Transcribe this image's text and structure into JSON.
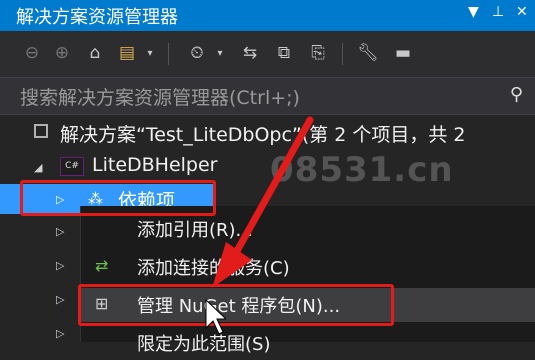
{
  "window": {
    "title": "解决方案资源管理器",
    "pin_glyph": "▾",
    "pin2_glyph": "ǂ",
    "close_glyph": "✕"
  },
  "toolbar": {
    "icons": [
      "back-icon",
      "forward-icon",
      "home-icon",
      "switch-views-icon",
      "dropdown-icon",
      "pending-changes-icon",
      "dropdown-icon",
      "sync-icon",
      "collapse-all-icon",
      "show-all-files-icon",
      "properties-icon",
      "preview-icon"
    ]
  },
  "search": {
    "placeholder": "搜索解决方案资源管理器(Ctrl+;)"
  },
  "tree": {
    "solution_label": "解决方案“Test_LiteDbOpc”(第 2 个项目，共 2",
    "project_label": "LiteDBHelper",
    "dependencies_label": "依赖项"
  },
  "context_menu": {
    "items": [
      {
        "label": "添加引用(R)..."
      },
      {
        "label": "添加连接的服务(C)"
      },
      {
        "label": "管理 NuGet 程序包(N)..."
      },
      {
        "label": "限定为此范围(S)"
      }
    ]
  },
  "watermark": "08531.cn",
  "colors": {
    "accent": "#007acc",
    "selection": "#3399ff",
    "highlight": "#e21b1b",
    "panel": "#252526"
  }
}
